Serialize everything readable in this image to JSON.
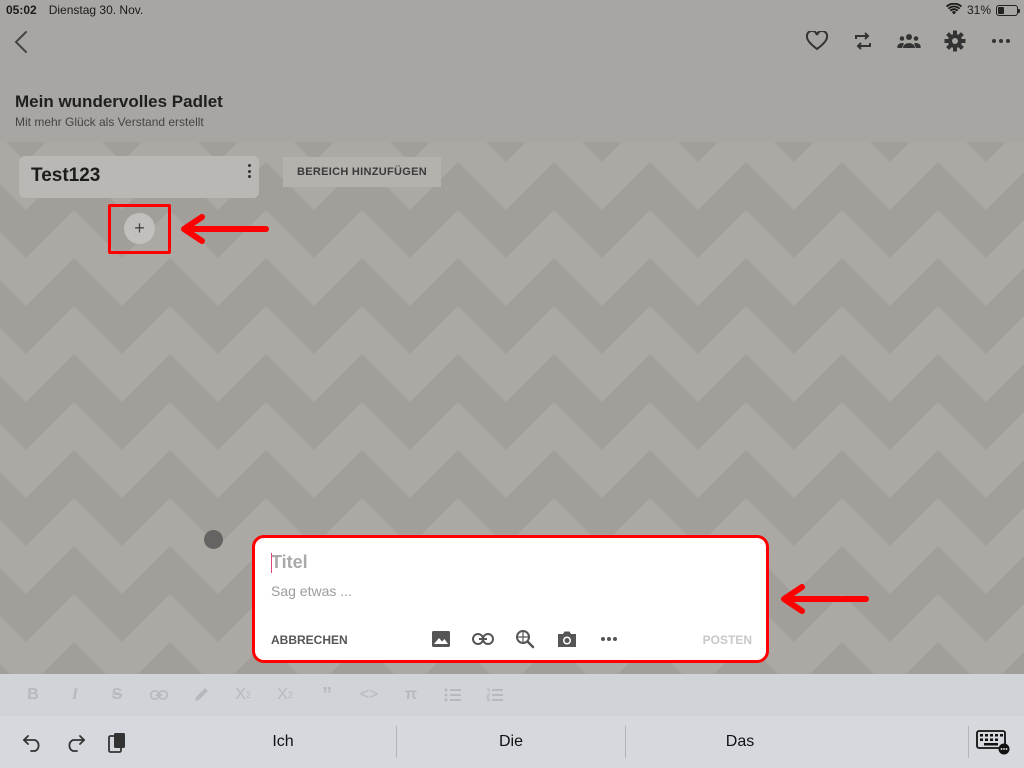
{
  "status_bar": {
    "time": "05:02",
    "date": "Dienstag 30. Nov.",
    "battery": "31%",
    "battery_level": 0.31
  },
  "toolbar": {
    "icons": [
      "back-icon",
      "heart-icon",
      "remake-icon",
      "people-icon",
      "gear-icon",
      "more-icon"
    ]
  },
  "padlet": {
    "title": "Mein wundervolles Padlet",
    "subtitle": "Mit mehr Glück als Verstand erstellt"
  },
  "section": {
    "name": "Test123",
    "add_section_label": "BEREICH HINZUFÜGEN",
    "add_post_label": "+"
  },
  "composer": {
    "title_placeholder": "Titel",
    "body_placeholder": "Sag etwas ...",
    "cancel_label": "ABBRECHEN",
    "post_label": "POSTEN",
    "tools": [
      "image-icon",
      "link-icon",
      "search-web-icon",
      "camera-icon",
      "more-icon"
    ]
  },
  "format_bar": {
    "items": [
      "B",
      "I",
      "S",
      "link",
      "pen",
      "X²",
      "X₂",
      "quote",
      "code",
      "π",
      "bullet-list",
      "numbered-list"
    ]
  },
  "keyboard": {
    "suggestions": [
      "Ich",
      "Die",
      "Das"
    ]
  },
  "colors": {
    "highlight": "#ff0000",
    "background": "#a9a6a2"
  }
}
